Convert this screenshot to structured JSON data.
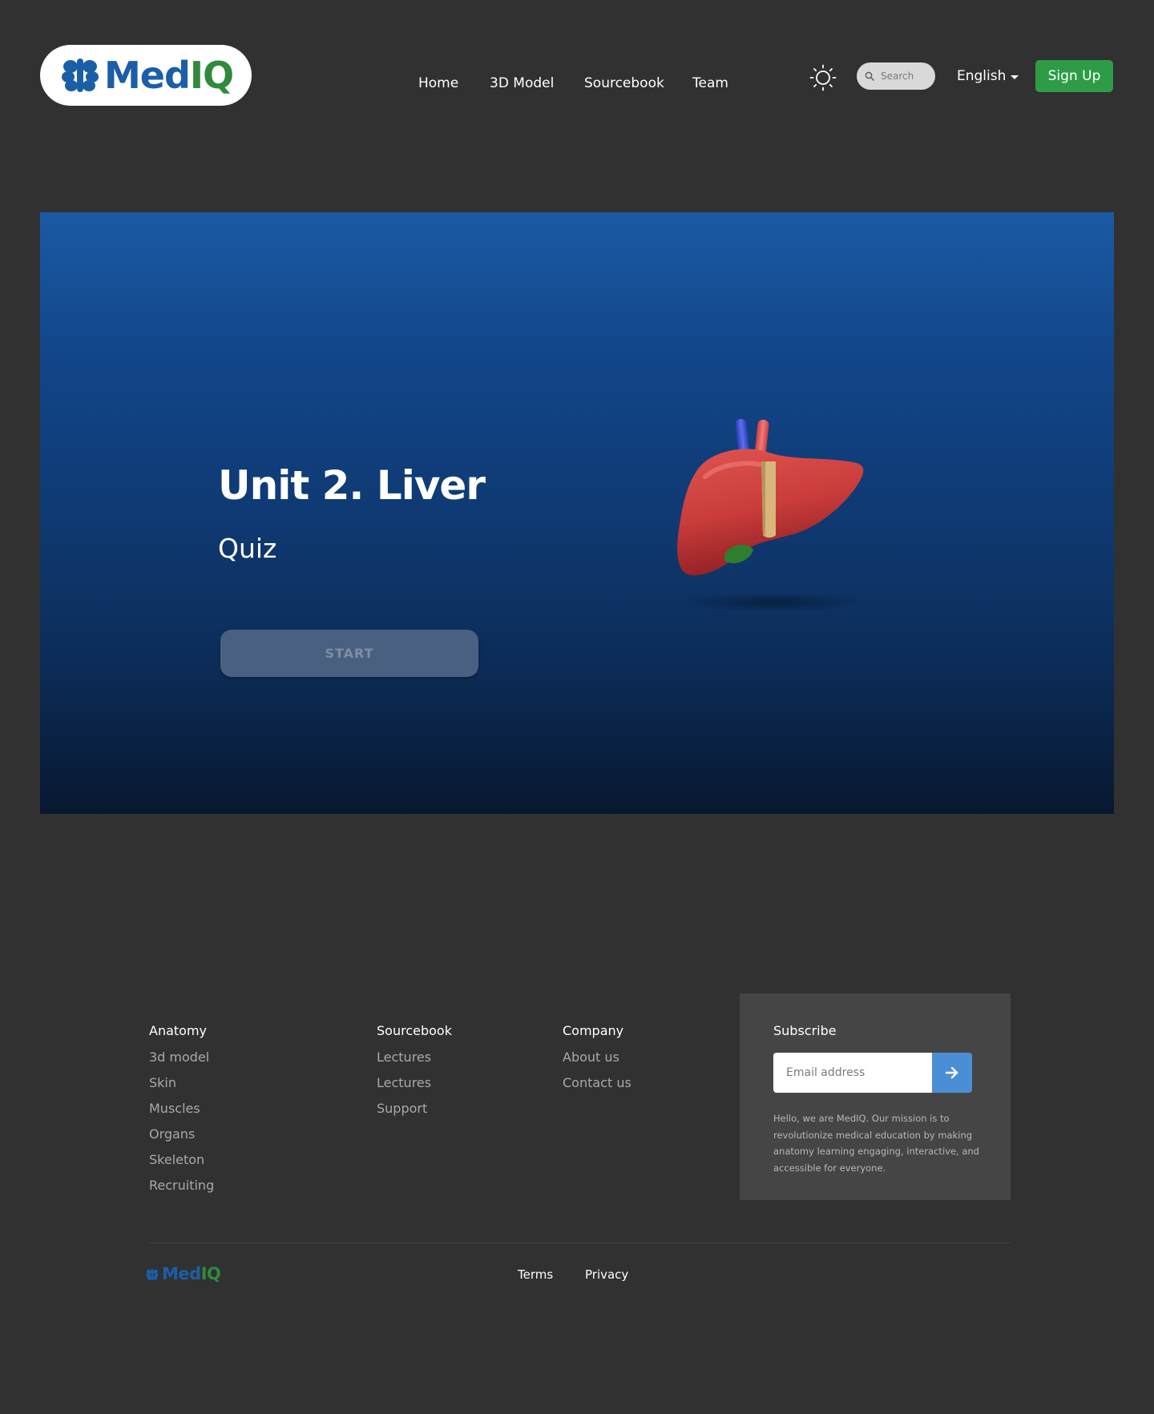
{
  "header": {
    "logo": {
      "med": "Med",
      "iq": "IQ"
    },
    "nav": [
      {
        "label": "Home"
      },
      {
        "label": "3D Model"
      },
      {
        "label": "Sourcebook"
      },
      {
        "label": "Team"
      }
    ],
    "theme_icon": "sun-icon",
    "search": {
      "placeholder": "Search",
      "icon": "search-icon"
    },
    "language": {
      "label": "English",
      "icon": "caret-down-icon"
    },
    "signup_label": "Sign Up"
  },
  "hero": {
    "title": "Unit 2. Liver",
    "subtitle": "Quiz",
    "start_label": "START",
    "image": "liver-illustration"
  },
  "footer": {
    "columns": [
      {
        "title": "Anatomy",
        "links": [
          "3d model",
          "Skin",
          "Muscles",
          "Organs",
          "Skeleton",
          "Recruiting"
        ]
      },
      {
        "title": "Sourcebook",
        "links": [
          "Lectures",
          "Lectures",
          "Support"
        ]
      },
      {
        "title": "Company",
        "links": [
          "About us",
          "Contact us"
        ]
      }
    ],
    "subscribe": {
      "title": "Subscribe",
      "placeholder": "Email address",
      "submit_icon": "arrow-right-icon",
      "description": "Hello, we are MedIQ. Our mission is to revolutionize medical education by making anatomy learning engaging, interactive, and accessible for everyone."
    },
    "bottom": {
      "logo": {
        "med": "Med",
        "iq": "IQ"
      },
      "terms": "Terms",
      "privacy": "Privacy"
    }
  },
  "colors": {
    "background": "#313131",
    "brand_blue": "#1b5ea8",
    "brand_green": "#2f8a3c",
    "signup_green": "#2e9c47",
    "subscribe_button": "#4a8fd6"
  }
}
